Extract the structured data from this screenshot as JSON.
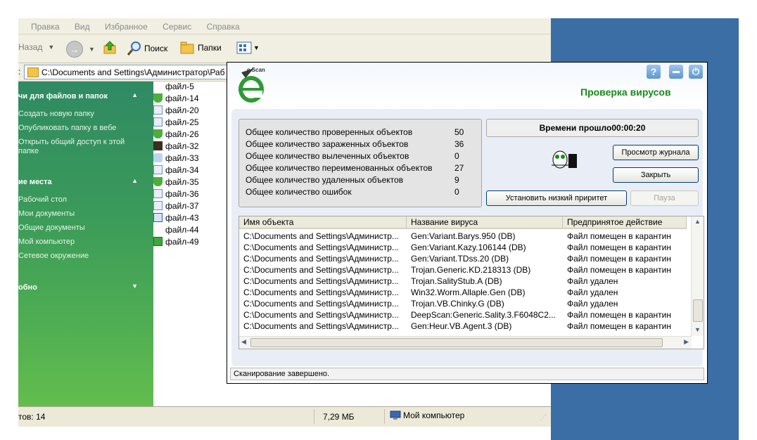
{
  "explorer": {
    "menu": [
      "Правка",
      "Вид",
      "Избранное",
      "Сервис",
      "Справка"
    ],
    "toolbar": {
      "back_label": "Назад",
      "search_label": "Поиск",
      "folders_label": "Папки"
    },
    "address_prefix": ":",
    "address_value": "C:\\Documents and Settings\\Администратор\\Раб",
    "tasks": {
      "file_tasks_title": "чи для файлов и папок",
      "file_tasks": [
        "Создать новую папку",
        "Опубликовать папку в вебе",
        "Открыть общий доступ к этой",
        "папке"
      ],
      "places_title": "ие места",
      "places": [
        "Рабочий стол",
        "Мои документы",
        "Общие документы",
        "Мой компьютер",
        "Сетевое окружение"
      ],
      "details_title": "обно"
    },
    "files": [
      {
        "name": "файл-5",
        "icon": "blank-icon"
      },
      {
        "name": "файл-14",
        "icon": "shield-icon"
      },
      {
        "name": "файл-20",
        "icon": "app-icon"
      },
      {
        "name": "файл-25",
        "icon": "app-icon"
      },
      {
        "name": "файл-26",
        "icon": "shield-icon"
      },
      {
        "name": "файл-32",
        "icon": "photo-icon"
      },
      {
        "name": "файл-33",
        "icon": "setup-icon"
      },
      {
        "name": "файл-34",
        "icon": "app-icon"
      },
      {
        "name": "файл-35",
        "icon": "shield-icon"
      },
      {
        "name": "файл-36",
        "icon": "app-icon"
      },
      {
        "name": "файл-37",
        "icon": "app-icon"
      },
      {
        "name": "файл-43",
        "icon": "installer-icon"
      },
      {
        "name": "файл-44",
        "icon": "blank-icon"
      },
      {
        "name": "файл-49",
        "icon": "box-icon"
      }
    ],
    "status": {
      "objects": "тов: 14",
      "size": "7,29 МБ",
      "location": "Мой компьютер"
    }
  },
  "escan": {
    "logo_text": "e Scan",
    "title": "Проверка вирусов",
    "stats": [
      {
        "label": "Общее количество проверенных объектов",
        "value": "50"
      },
      {
        "label": "Общее количество зараженных объектов",
        "value": "36"
      },
      {
        "label": "Общее количество вылеченных объектов",
        "value": "0"
      },
      {
        "label": "Общее количество переименованных объектов",
        "value": "27"
      },
      {
        "label": "Общее количество удаленных объектов",
        "value": "9"
      },
      {
        "label": "Общее количество ошибок",
        "value": "0"
      }
    ],
    "elapsed": "Времени прошло00:00:20",
    "buttons": {
      "view_log": "Просмотр журнала",
      "close": "Закрыть",
      "low_priority": "Установить низкий приритет",
      "pause": "Пауза"
    },
    "table": {
      "headers": [
        "Имя объекта",
        "Название вируса",
        "Предпринятое действие"
      ],
      "rows": [
        [
          "C:\\Documents and Settings\\Администр...",
          "Gen:Variant.Barys.950 (DB)",
          "Файл помещен в карантин"
        ],
        [
          "C:\\Documents and Settings\\Администр...",
          "Gen:Variant.Kazy.106144 (DB)",
          "Файл помещен в карантин"
        ],
        [
          "C:\\Documents and Settings\\Администр...",
          "Gen:Variant.TDss.20 (DB)",
          "Файл помещен в карантин"
        ],
        [
          "C:\\Documents and Settings\\Администр...",
          "Trojan.Generic.KD.218313 (DB)",
          "Файл помещен в карантин"
        ],
        [
          "C:\\Documents and Settings\\Администр...",
          "Trojan.SalityStub.A (DB)",
          "Файл удален"
        ],
        [
          "C:\\Documents and Settings\\Администр...",
          "Win32.Worm.Allaple.Gen (DB)",
          "Файл удален"
        ],
        [
          "C:\\Documents and Settings\\Администр...",
          "Trojan.VB.Chinky.G (DB)",
          "Файл удален"
        ],
        [
          "C:\\Documents and Settings\\Администр...",
          "DeepScan:Generic.Sality.3.F6048C2...",
          "Файл помещен в карантин"
        ],
        [
          "C:\\Documents and Settings\\Администр...",
          "Gen:Heur.VB.Agent.3 (DB)",
          "Файл помещен в карантин"
        ]
      ]
    },
    "status": "Сканирование завершено."
  }
}
